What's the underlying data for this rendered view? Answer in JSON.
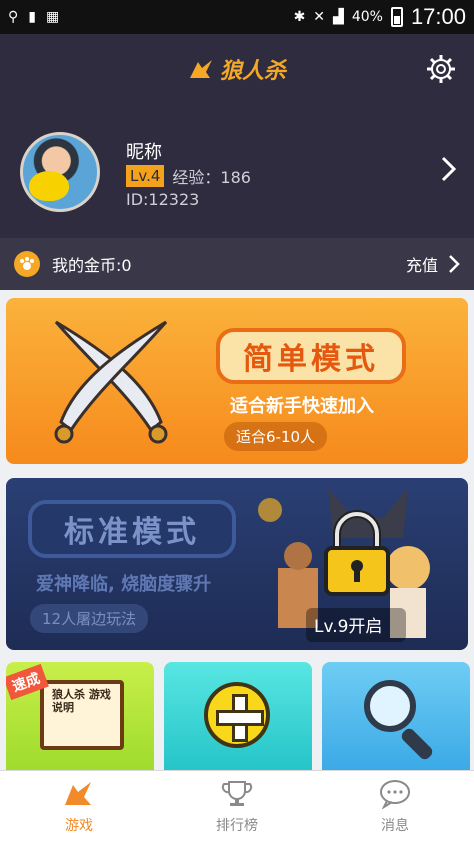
{
  "status_bar": {
    "battery": "40%",
    "time": "17:00"
  },
  "header": {
    "app_name": "狼人杀"
  },
  "profile": {
    "nickname": "昵称",
    "level": "Lv.4",
    "exp_label": "经验：186",
    "id_label": "ID:12323"
  },
  "coins": {
    "label": "我的金币:0",
    "recharge": "充值"
  },
  "modes": {
    "easy": {
      "title": "简单模式",
      "subtitle": "适合新手快速加入",
      "players": "适合6-10人"
    },
    "standard": {
      "title": "标准模式",
      "subtitle": "爱神降临, 烧脑度骤升",
      "players": "12人屠边玩法",
      "lock_text": "Lv.9开启"
    }
  },
  "mini_cards": {
    "speed_tag": "速成",
    "book_title": "狼人杀 游戏说明"
  },
  "tabs": [
    {
      "label": "游戏"
    },
    {
      "label": "排行榜"
    },
    {
      "label": "消息"
    }
  ],
  "colors": {
    "accent": "#f5a826",
    "header_bg": "#2f2c3f",
    "tab_active": "#f08a2a"
  }
}
